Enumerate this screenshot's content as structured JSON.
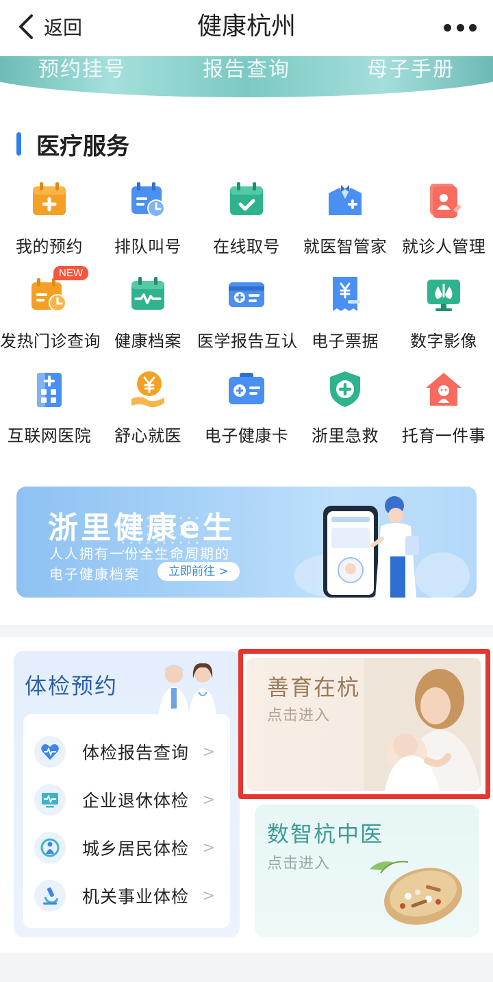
{
  "navbar": {
    "back_label": "返回",
    "title": "健康杭州"
  },
  "top_links": [
    "预约挂号",
    "报告查询",
    "母子手册"
  ],
  "section": {
    "title": "医疗服务"
  },
  "services": [
    {
      "label": "我的预约",
      "icon": "calendar-plus-icon"
    },
    {
      "label": "排队叫号",
      "icon": "queue-clock-icon"
    },
    {
      "label": "在线取号",
      "icon": "calendar-check-icon"
    },
    {
      "label": "就医智管家",
      "icon": "butler-icon"
    },
    {
      "label": "就诊人管理",
      "icon": "patient-card-icon"
    },
    {
      "label": "发热门诊查询",
      "icon": "fever-clinic-icon",
      "badge": "NEW"
    },
    {
      "label": "健康档案",
      "icon": "heartbeat-calendar-icon"
    },
    {
      "label": "医学报告互认",
      "icon": "report-card-icon"
    },
    {
      "label": "电子票据",
      "icon": "receipt-icon"
    },
    {
      "label": "数字影像",
      "icon": "xray-monitor-icon"
    },
    {
      "label": "互联网医院",
      "icon": "hospital-building-icon"
    },
    {
      "label": "舒心就医",
      "icon": "yen-hand-icon"
    },
    {
      "label": "电子健康卡",
      "icon": "health-card-icon"
    },
    {
      "label": "浙里急救",
      "icon": "shield-cross-icon"
    },
    {
      "label": "托育一件事",
      "icon": "baby-house-icon"
    }
  ],
  "promo": {
    "title": "浙里健康e生",
    "line1": "人人拥有一份全生命周期的",
    "line2": "电子健康档案",
    "button": "立即前往 >"
  },
  "exam_card": {
    "title": "体检预约",
    "items": [
      {
        "label": "体检报告查询",
        "icon": "heart-pulse-icon"
      },
      {
        "label": "企业退休体检",
        "icon": "monitor-pulse-icon"
      },
      {
        "label": "城乡居民体检",
        "icon": "person-ring-icon"
      },
      {
        "label": "机关事业体检",
        "icon": "microscope-icon"
      }
    ],
    "arrow": ">"
  },
  "shanyu_card": {
    "title": "善育在杭",
    "sub": "点击进入"
  },
  "tcm_card": {
    "title": "数智杭中医",
    "sub": "点击进入"
  },
  "colors": {
    "accent": "#2f7ff0",
    "highlight_frame": "#e5372f",
    "orange": "#f5a024",
    "teal": "#35b59a"
  }
}
